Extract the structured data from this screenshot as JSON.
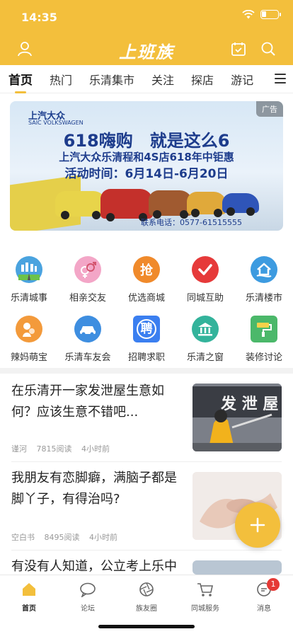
{
  "status_bar": {
    "time": "14:35"
  },
  "app": {
    "logo": "上班族"
  },
  "tabs": [
    {
      "label": "首页",
      "active": true
    },
    {
      "label": "热门"
    },
    {
      "label": "乐清集市"
    },
    {
      "label": "关注"
    },
    {
      "label": "探店"
    },
    {
      "label": "游记"
    }
  ],
  "banner": {
    "ad_tag": "广告",
    "brand": "上汽大众",
    "brand_en": "SAIC VOLKSWAGEN",
    "headline": "618嗨购　就是这么6",
    "subline": "上汽大众乐清程和4S店618年中钜惠",
    "event_time": "活动时间：6月14日-6月20日",
    "phone": "联系电话：0577-61515555"
  },
  "shortcuts": [
    {
      "label": "乐清城事",
      "icon": "city-road-icon",
      "color": "#4aa3df"
    },
    {
      "label": "相亲交友",
      "icon": "gender-match-icon",
      "color": "#f3a6c7"
    },
    {
      "label": "优选商城",
      "icon": "grab-deal-icon",
      "color": "#f08a2b",
      "glyph": "抢"
    },
    {
      "label": "同城互助",
      "icon": "check-help-icon",
      "color": "#e63a3a"
    },
    {
      "label": "乐清楼市",
      "icon": "house-market-icon",
      "color": "#3d9be0"
    },
    {
      "label": "辣妈萌宝",
      "icon": "mother-baby-icon",
      "color": "#f39a3b"
    },
    {
      "label": "乐清车友会",
      "icon": "car-club-icon",
      "color": "#3e8ee0"
    },
    {
      "label": "招聘求职",
      "icon": "recruit-icon",
      "color": "#3b7ff0",
      "glyph": "聘"
    },
    {
      "label": "乐清之窗",
      "icon": "landmark-icon",
      "color": "#33b39b"
    },
    {
      "label": "装修讨论",
      "icon": "paint-roller-icon",
      "color": "#4bb86a"
    }
  ],
  "feed": [
    {
      "title": "在乐清开一家发泄屋生意如何？应该生意不错吧...",
      "author": "谨河",
      "reads": "7815阅读",
      "time": "4小时前",
      "thumb_text": "发 泄 屋"
    },
    {
      "title": "我朋友有恋脚癖，满脑子都是脚丫子，有得治吗?",
      "author": "空白书",
      "reads": "8495阅读",
      "time": "4小时前"
    },
    {
      "title": "有没有人知道，公立考上乐中"
    }
  ],
  "bottom_nav": [
    {
      "label": "首页",
      "icon": "home-icon",
      "active": true
    },
    {
      "label": "论坛",
      "icon": "forum-chat-icon"
    },
    {
      "label": "族友圈",
      "icon": "camera-aperture-icon"
    },
    {
      "label": "同城服务",
      "icon": "shopping-cart-icon"
    },
    {
      "label": "消息",
      "icon": "message-icon",
      "badge": "1"
    }
  ],
  "colors": {
    "brand": "#f3bf3c",
    "badge": "#e53935"
  }
}
